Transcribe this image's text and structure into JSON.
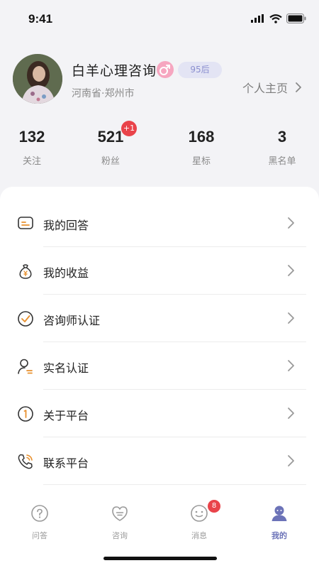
{
  "status_bar": {
    "time": "9:41"
  },
  "profile": {
    "name": "白羊心理咨询",
    "age_badge": "95后",
    "location": "河南省·郑州市",
    "homepage_label": "个人主页"
  },
  "stats": [
    {
      "value": "132",
      "label": "关注"
    },
    {
      "value": "521",
      "label": "粉丝",
      "badge": "+1"
    },
    {
      "value": "168",
      "label": "星标"
    },
    {
      "value": "3",
      "label": "黑名单"
    }
  ],
  "menu": [
    {
      "label": "我的回答",
      "icon": "answer-icon"
    },
    {
      "label": "我的收益",
      "icon": "money-bag-icon"
    },
    {
      "label": "咨询师认证",
      "icon": "check-circle-icon"
    },
    {
      "label": "实名认证",
      "icon": "user-verify-icon"
    },
    {
      "label": "关于平台",
      "icon": "info-circle-icon"
    },
    {
      "label": "联系平台",
      "icon": "phone-icon"
    }
  ],
  "tabs": [
    {
      "label": "问答",
      "icon": "question-icon"
    },
    {
      "label": "咨询",
      "icon": "consult-icon"
    },
    {
      "label": "消息",
      "icon": "message-icon",
      "badge": "8"
    },
    {
      "label": "我的",
      "icon": "profile-icon",
      "active": true
    }
  ],
  "colors": {
    "accent": "#6c73b8",
    "badge": "#e9434a",
    "icon_orange": "#e8912f"
  }
}
